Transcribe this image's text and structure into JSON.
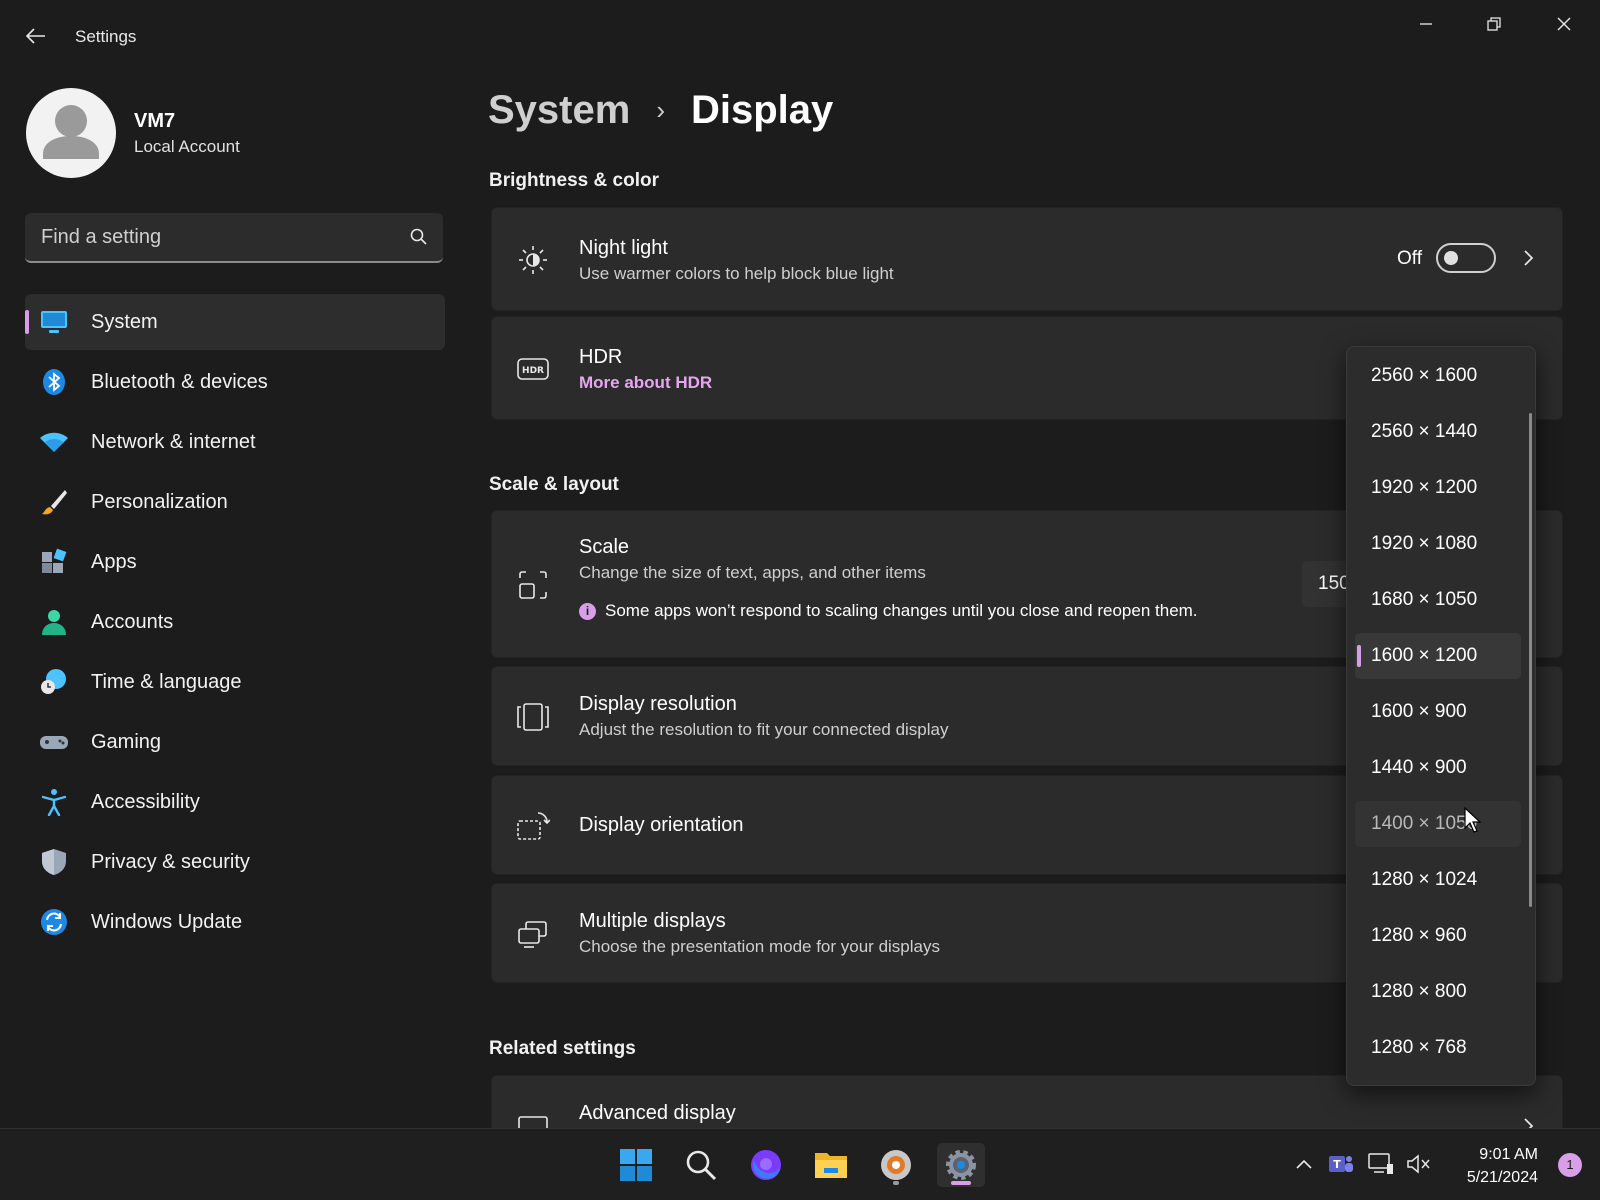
{
  "window": {
    "title": "Settings",
    "back_icon": "arrow-left-icon",
    "controls": [
      "minimize-icon",
      "restore-icon",
      "close-icon"
    ]
  },
  "user": {
    "name": "VM7",
    "account_type": "Local Account"
  },
  "search": {
    "placeholder": "Find a setting"
  },
  "sidebar": {
    "items": [
      {
        "label": "System",
        "icon": "monitor-icon",
        "active": true
      },
      {
        "label": "Bluetooth & devices",
        "icon": "bluetooth-icon"
      },
      {
        "label": "Network & internet",
        "icon": "wifi-icon"
      },
      {
        "label": "Personalization",
        "icon": "brush-icon"
      },
      {
        "label": "Apps",
        "icon": "apps-icon"
      },
      {
        "label": "Accounts",
        "icon": "person-icon"
      },
      {
        "label": "Time & language",
        "icon": "globe-clock-icon"
      },
      {
        "label": "Gaming",
        "icon": "controller-icon"
      },
      {
        "label": "Accessibility",
        "icon": "accessibility-icon"
      },
      {
        "label": "Privacy & security",
        "icon": "shield-icon"
      },
      {
        "label": "Windows Update",
        "icon": "update-icon"
      }
    ]
  },
  "breadcrumb": {
    "parent": "System",
    "separator": "›",
    "current": "Display"
  },
  "sections": {
    "brightness": "Brightness & color",
    "scale_layout": "Scale & layout",
    "related": "Related settings"
  },
  "cards": {
    "night_light": {
      "title": "Night light",
      "subtitle": "Use warmer colors to help block blue light",
      "toggle_label": "Off",
      "toggle_on": false
    },
    "hdr": {
      "title": "HDR",
      "link": "More about HDR"
    },
    "scale": {
      "title": "Scale",
      "subtitle": "Change the size of text, apps, and other items",
      "info": "Some apps won’t respond to scaling changes until you close and reopen them.",
      "value": "150"
    },
    "resolution": {
      "title": "Display resolution",
      "subtitle": "Adjust the resolution to fit your connected display"
    },
    "orientation": {
      "title": "Display orientation"
    },
    "multiple": {
      "title": "Multiple displays",
      "subtitle": "Choose the presentation mode for your displays"
    },
    "advanced": {
      "title": "Advanced display"
    }
  },
  "resolution_dropdown": {
    "options": [
      "2560 × 1600",
      "2560 × 1440",
      "1920 × 1200",
      "1920 × 1080",
      "1680 × 1050",
      "1600 × 1200",
      "1600 × 900",
      "1440 × 900",
      "1400 × 1050",
      "1280 × 1024",
      "1280 × 960",
      "1280 × 800",
      "1280 × 768"
    ],
    "selected": "1600 × 1200",
    "hovered": "1400 × 1050"
  },
  "taskbar": {
    "apps": [
      "start-icon",
      "search-icon",
      "firefox-icon",
      "file-explorer-icon",
      "media-app-icon",
      "settings-icon"
    ],
    "tray": [
      "chevron-up-icon",
      "teams-icon",
      "network-icon",
      "sound-muted-icon"
    ],
    "time": "9:01 AM",
    "date": "5/21/2024",
    "notification_count": "1"
  },
  "colors": {
    "accent": "#d99ee8",
    "background": "#1c1c1c",
    "card": "#2b2b2b"
  }
}
